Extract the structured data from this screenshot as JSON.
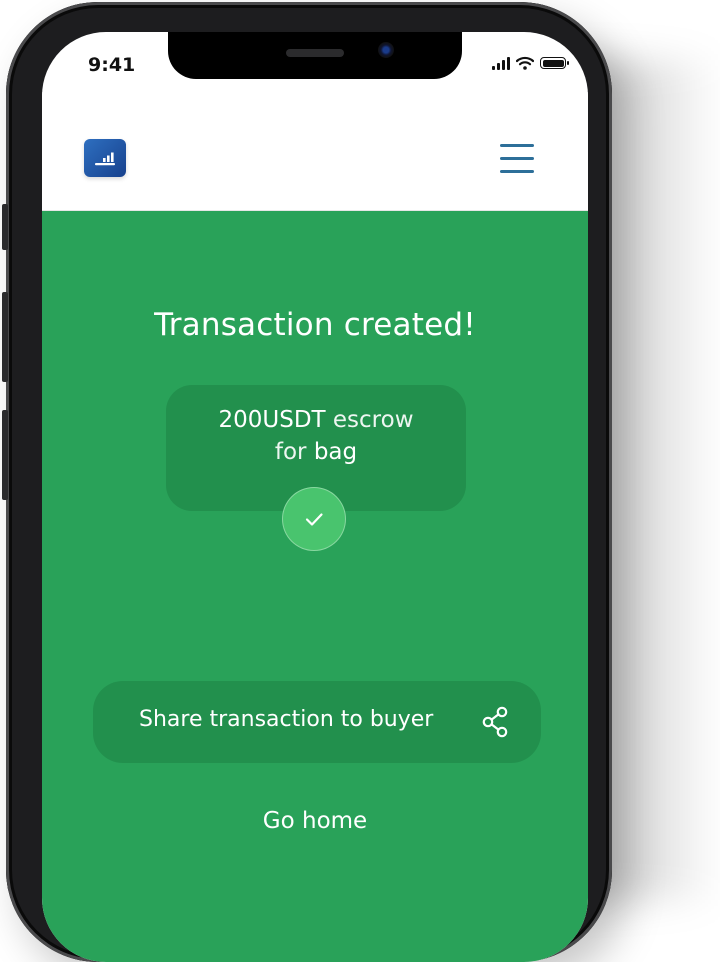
{
  "status_bar": {
    "time": "9:41"
  },
  "header": {
    "logo_icon": "bar-chart-logo-icon",
    "menu_icon": "hamburger-menu-icon"
  },
  "main": {
    "title": "Transaction created!",
    "card": {
      "amount": "200USDT",
      "type": "escrow",
      "for_label": "for",
      "item": "bag"
    },
    "status_icon": "check-icon",
    "share_button": {
      "label": "Share transaction to buyer",
      "icon": "share-icon"
    },
    "go_home_label": "Go home"
  },
  "colors": {
    "background_green": "#29a259",
    "card_green": "#22904d",
    "check_circle": "#49c46e",
    "menu_blue": "#2d6f99",
    "logo_blue": "#1f55a8"
  }
}
